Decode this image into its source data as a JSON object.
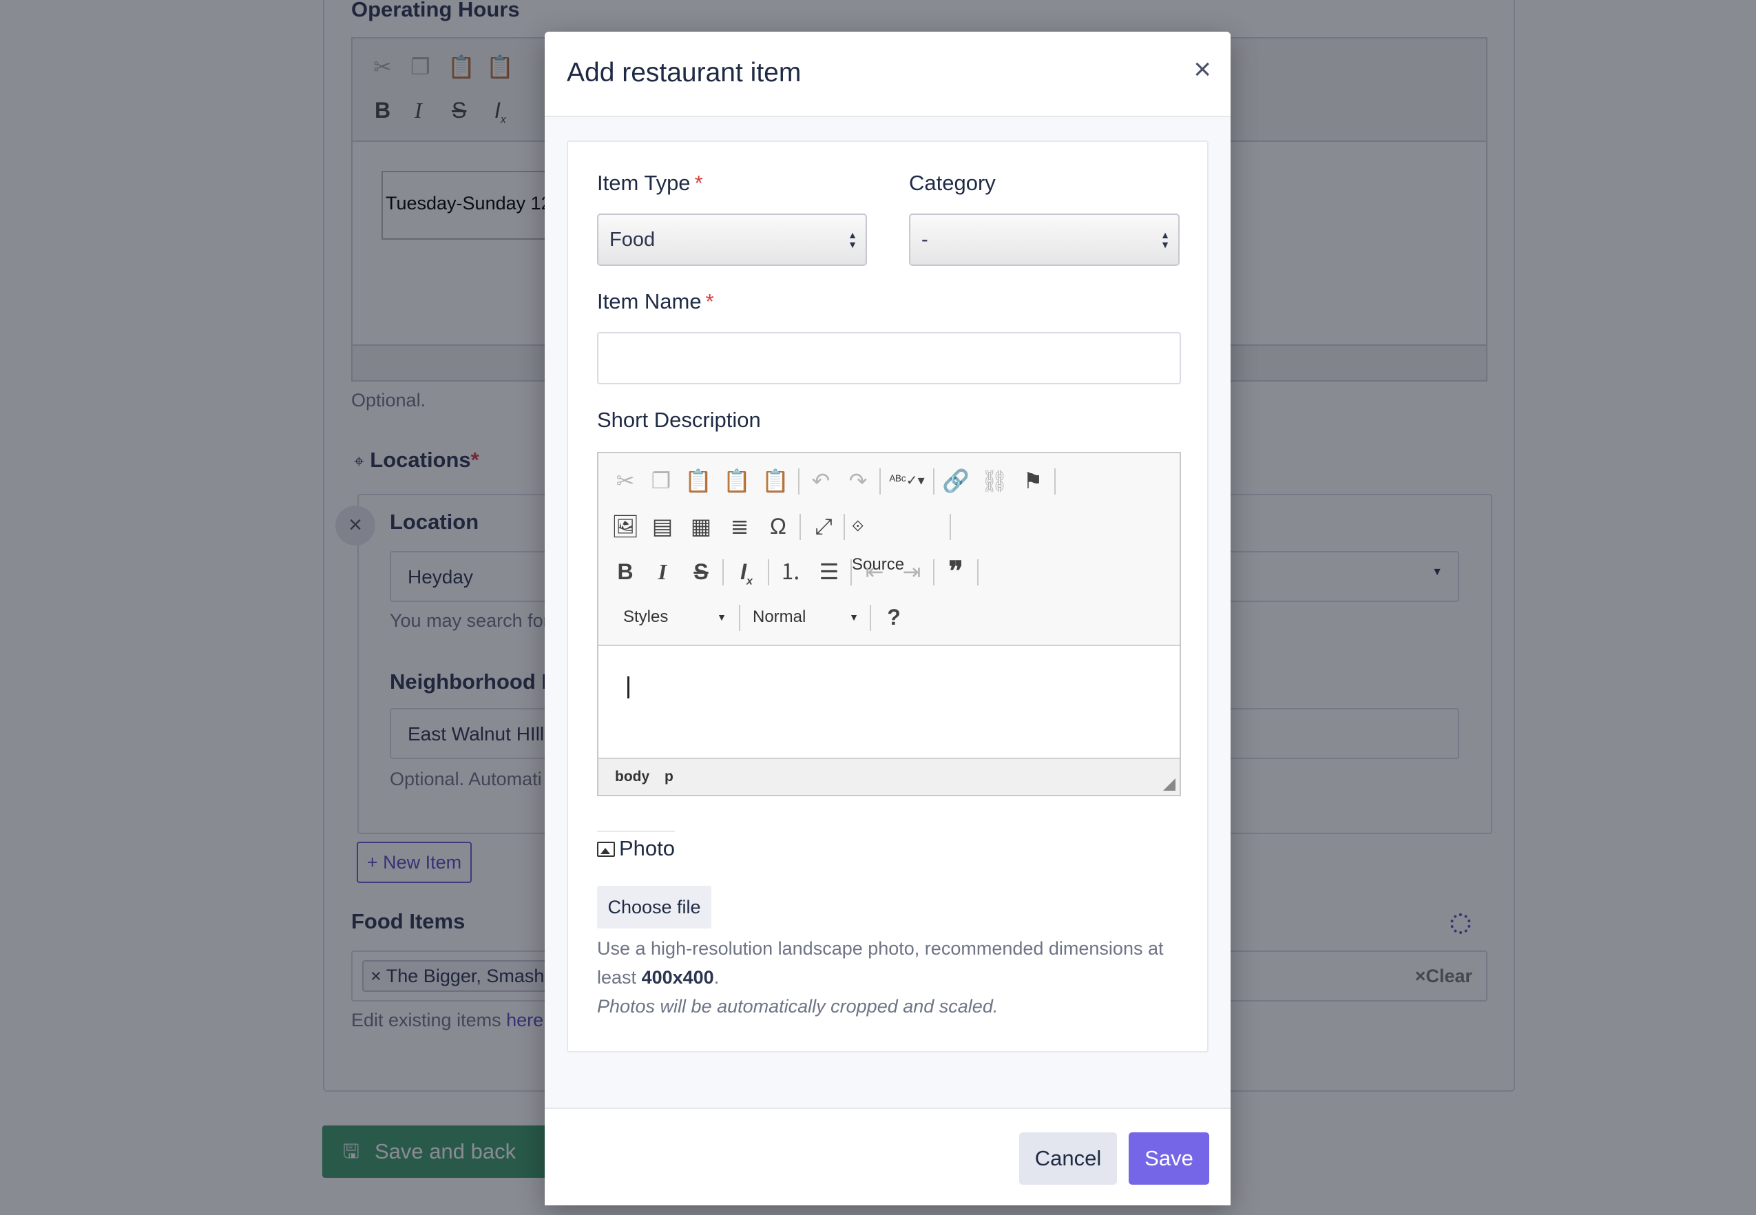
{
  "background": {
    "operating_hours_label": "Operating Hours",
    "operating_hours_content": "Tuesday-Sunday 12-",
    "optional_text": "Optional.",
    "locations_label": "Locations",
    "location_label": "Location",
    "location_value": "Heyday",
    "location_help": "You may search for",
    "neighborhood_label": "Neighborhood N",
    "neighborhood_value": "East Walnut HIlls",
    "neighborhood_help": "Optional. Automati",
    "new_item_label": "+ New Item",
    "food_items_label": "Food Items",
    "food_item_tag": "The Bigger, Smashe",
    "clear_label": "×Clear",
    "edit_existing_text": "Edit existing items",
    "edit_existing_link": "here",
    "save_and_back_label": "Save and back"
  },
  "modal": {
    "title": "Add restaurant item",
    "close_glyph": "×",
    "item_type_label": "Item Type",
    "item_type_value": "Food",
    "category_label": "Category",
    "category_value": "-",
    "item_name_label": "Item Name",
    "item_name_value": "",
    "short_description_label": "Short Description",
    "editor": {
      "source_label": "Source",
      "styles_label": "Styles",
      "format_label": "Normal",
      "path_body": "body",
      "path_p": "p"
    },
    "photo_label": "Photo",
    "choose_file_label": "Choose file",
    "help_text_prefix": "Use a high-resolution landscape photo, recommended dimensions at least",
    "help_text_dims": "400x400",
    "help_text_suffix": ".",
    "help_text_italic": "Photos will be automatically cropped and scaled.",
    "cancel_label": "Cancel",
    "save_label": "Save"
  },
  "colors": {
    "primary": "#7466e6",
    "success": "#3c9a6a",
    "required": "#d93a3a"
  }
}
